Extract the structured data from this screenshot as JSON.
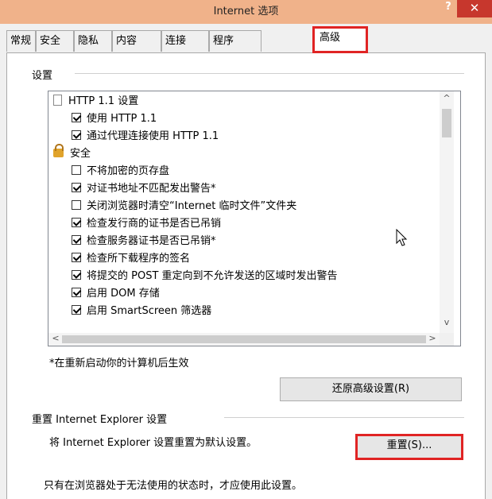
{
  "window": {
    "title": "Internet 选项",
    "help": "?",
    "close": "✕"
  },
  "tabs": [
    "常规",
    "安全",
    "隐私",
    "内容",
    "连接",
    "程序",
    "高级"
  ],
  "settings_group": {
    "label": "设置",
    "items": [
      {
        "type": "page",
        "label": "HTTP 1.1 设置"
      },
      {
        "type": "check",
        "checked": true,
        "label": "使用 HTTP 1.1"
      },
      {
        "type": "check",
        "checked": true,
        "label": "通过代理连接使用 HTTP 1.1"
      },
      {
        "type": "lock",
        "label": "安全"
      },
      {
        "type": "check",
        "checked": false,
        "label": "不将加密的页存盘"
      },
      {
        "type": "check",
        "checked": true,
        "label": "对证书地址不匹配发出警告*"
      },
      {
        "type": "check",
        "checked": false,
        "label": "关闭浏览器时清空“Internet 临时文件”文件夹"
      },
      {
        "type": "check",
        "checked": true,
        "label": "检查发行商的证书是否已吊销"
      },
      {
        "type": "check",
        "checked": true,
        "label": "检查服务器证书是否已吊销*"
      },
      {
        "type": "check",
        "checked": true,
        "label": "检查所下载程序的签名"
      },
      {
        "type": "check",
        "checked": true,
        "label": "将提交的 POST 重定向到不允许发送的区域时发出警告"
      },
      {
        "type": "check",
        "checked": true,
        "label": "启用 DOM 存储"
      },
      {
        "type": "check",
        "checked": true,
        "label": "启用 SmartScreen 筛选器"
      }
    ],
    "restart_note": "*在重新启动你的计算机后生效",
    "restore_button": "还原高级设置(R)"
  },
  "reset_group": {
    "label": "重置 Internet Explorer 设置",
    "description": "将 Internet Explorer 设置重置为默认设置。",
    "reset_button": "重置(S)...",
    "warning": "只有在浏览器处于无法使用的状态时，才应使用此设置。"
  },
  "scroll_arrows": {
    "up": "^",
    "down": "v",
    "left": "<",
    "right": ">"
  }
}
